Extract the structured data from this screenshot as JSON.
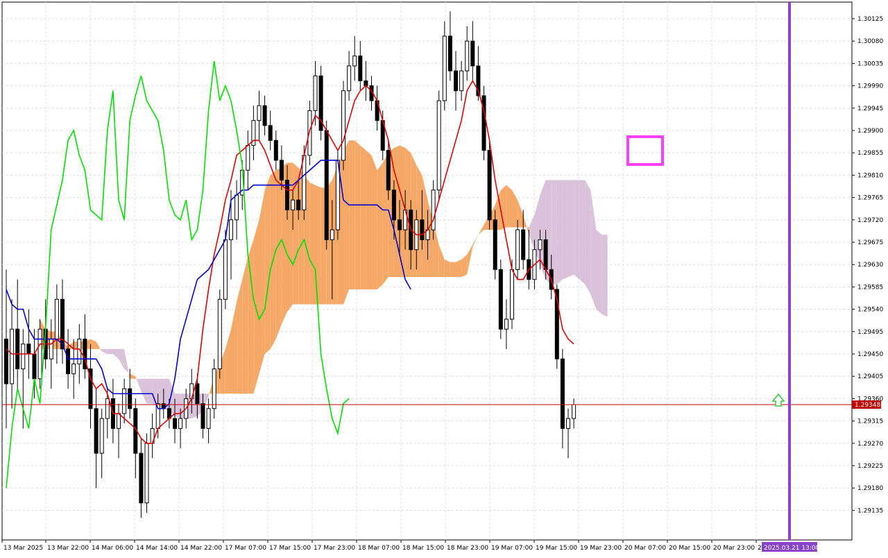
{
  "chart_data": {
    "type": "candlestick",
    "y_axis": {
      "ticks": [
        "1.30125",
        "1.30080",
        "1.30035",
        "1.29990",
        "1.29945",
        "1.29900",
        "1.29855",
        "1.29810",
        "1.29765",
        "1.29720",
        "1.29675",
        "1.29630",
        "1.29585",
        "1.29540",
        "1.29495",
        "1.29450",
        "1.29405",
        "1.29360",
        "1.29315",
        "1.29270",
        "1.29225",
        "1.29180",
        "1.29135"
      ],
      "range": [
        1.291,
        1.3016
      ],
      "position": "right"
    },
    "x_axis": {
      "ticks": [
        "13 Mar 2025",
        "13 Mar 22:00",
        "14 Mar 06:00",
        "14 Mar 14:00",
        "14 Mar 22:00",
        "17 Mar 07:00",
        "17 Mar 15:00",
        "17 Mar 23:00",
        "18 Mar 07:00",
        "18 Mar 15:00",
        "18 Mar 23:00",
        "19 Mar 07:00",
        "19 Mar 15:00",
        "19 Mar 23:00",
        "20 Mar 07:00",
        "20 Mar 15:00",
        "20 Mar 23:00",
        "21"
      ],
      "highlight_label": "2025.03.21 13:00"
    },
    "current_price": {
      "label": "1.29348",
      "value": 1.29348
    },
    "grid": true,
    "colors": {
      "bull_candle": "#ffffff",
      "bear_candle": "#000000",
      "tenkan": "#e00000",
      "kijun": "#0000d0",
      "chikou": "#00e000",
      "kumo_bull": "#f4a460",
      "kumo_bear": "#d8bfd8",
      "marker": "#ff40ff",
      "vline": "#9040d0",
      "arrow": "#32cd32",
      "price_line": "#c00000"
    },
    "candles": [
      [
        1.2948,
        1.2962,
        1.293,
        1.2939
      ],
      [
        1.2939,
        1.2956,
        1.2934,
        1.295
      ],
      [
        1.295,
        1.296,
        1.2938,
        1.2942
      ],
      [
        1.2942,
        1.295,
        1.293,
        1.2947
      ],
      [
        1.2947,
        1.2954,
        1.294,
        1.2945
      ],
      [
        1.2945,
        1.295,
        1.2936,
        1.294
      ],
      [
        1.294,
        1.2952,
        1.2938,
        1.295
      ],
      [
        1.295,
        1.2956,
        1.2942,
        1.2944
      ],
      [
        1.2944,
        1.2952,
        1.2938,
        1.2948
      ],
      [
        1.2948,
        1.2959,
        1.2943,
        1.2956
      ],
      [
        1.2956,
        1.296,
        1.2943,
        1.2946
      ],
      [
        1.2946,
        1.295,
        1.2938,
        1.2941
      ],
      [
        1.2941,
        1.2948,
        1.2936,
        1.2943
      ],
      [
        1.2943,
        1.2951,
        1.2939,
        1.2948
      ],
      [
        1.2948,
        1.2953,
        1.294,
        1.2942
      ],
      [
        1.2942,
        1.2947,
        1.293,
        1.2934
      ],
      [
        1.2934,
        1.2938,
        1.2918,
        1.2925
      ],
      [
        1.2925,
        1.2934,
        1.292,
        1.2932
      ],
      [
        1.2932,
        1.2938,
        1.2928,
        1.2936
      ],
      [
        1.2936,
        1.294,
        1.2927,
        1.293
      ],
      [
        1.293,
        1.2935,
        1.2924,
        1.2933
      ],
      [
        1.2933,
        1.294,
        1.2931,
        1.2938
      ],
      [
        1.2938,
        1.2942,
        1.2932,
        1.2934
      ],
      [
        1.2934,
        1.2936,
        1.292,
        1.2925
      ],
      [
        1.2925,
        1.2928,
        1.2912,
        1.2915
      ],
      [
        1.2915,
        1.2929,
        1.2913,
        1.2927
      ],
      [
        1.2927,
        1.2933,
        1.2924,
        1.293
      ],
      [
        1.293,
        1.2937,
        1.2928,
        1.2935
      ],
      [
        1.2935,
        1.2938,
        1.2932,
        1.2934
      ],
      [
        1.2934,
        1.2936,
        1.293,
        1.2932
      ],
      [
        1.2932,
        1.2936,
        1.2927,
        1.293
      ],
      [
        1.293,
        1.2934,
        1.2926,
        1.2932
      ],
      [
        1.2932,
        1.2938,
        1.293,
        1.2936
      ],
      [
        1.2936,
        1.2942,
        1.2933,
        1.2939
      ],
      [
        1.2939,
        1.2941,
        1.2932,
        1.2935
      ],
      [
        1.2935,
        1.2937,
        1.2928,
        1.293
      ],
      [
        1.293,
        1.2936,
        1.2927,
        1.2934
      ],
      [
        1.2934,
        1.2944,
        1.2932,
        1.2942
      ],
      [
        1.2942,
        1.2958,
        1.294,
        1.2956
      ],
      [
        1.2956,
        1.297,
        1.2954,
        1.2968
      ],
      [
        1.2968,
        1.2978,
        1.296,
        1.2972
      ],
      [
        1.2972,
        1.298,
        1.2968,
        1.2977
      ],
      [
        1.2977,
        1.2984,
        1.2974,
        1.2982
      ],
      [
        1.2982,
        1.299,
        1.2978,
        1.2987
      ],
      [
        1.2987,
        1.2995,
        1.2984,
        1.2992
      ],
      [
        1.2992,
        1.2998,
        1.2988,
        1.2995
      ],
      [
        1.2995,
        1.2997,
        1.2989,
        1.2991
      ],
      [
        1.2991,
        1.2994,
        1.2986,
        1.2988
      ],
      [
        1.2988,
        1.299,
        1.2982,
        1.2984
      ],
      [
        1.2984,
        1.2987,
        1.2978,
        1.298
      ],
      [
        1.298,
        1.2983,
        1.2972,
        1.2974
      ],
      [
        1.2974,
        1.2978,
        1.297,
        1.2976
      ],
      [
        1.2976,
        1.298,
        1.2972,
        1.2974
      ],
      [
        1.2974,
        1.2987,
        1.2972,
        1.2985
      ],
      [
        1.2985,
        1.2996,
        1.2983,
        1.2994
      ],
      [
        1.2994,
        1.3004,
        1.2991,
        1.3001
      ],
      [
        1.3001,
        1.3003,
        1.2988,
        1.299
      ],
      [
        1.299,
        1.2992,
        1.2966,
        1.2968
      ],
      [
        1.2968,
        1.2976,
        1.2956,
        1.297
      ],
      [
        1.297,
        1.2986,
        1.2968,
        1.2984
      ],
      [
        1.2984,
        1.3,
        1.2982,
        1.2998
      ],
      [
        1.2998,
        1.3006,
        1.2996,
        1.3003
      ],
      [
        1.3003,
        1.3009,
        1.3,
        1.3005
      ],
      [
        1.3005,
        1.3008,
        1.2998,
        1.3
      ],
      [
        1.3,
        1.3004,
        1.2996,
        1.2999
      ],
      [
        1.2999,
        1.3001,
        1.2994,
        1.2996
      ],
      [
        1.2996,
        1.2999,
        1.299,
        1.2992
      ],
      [
        1.2992,
        1.2994,
        1.2984,
        1.2986
      ],
      [
        1.2986,
        1.2988,
        1.2976,
        1.2978
      ],
      [
        1.2978,
        1.298,
        1.2968,
        1.2972
      ],
      [
        1.2972,
        1.2976,
        1.2965,
        1.297
      ],
      [
        1.297,
        1.2978,
        1.2966,
        1.2974
      ],
      [
        1.2974,
        1.2976,
        1.2962,
        1.2966
      ],
      [
        1.2966,
        1.2974,
        1.2962,
        1.2972
      ],
      [
        1.2972,
        1.2978,
        1.2966,
        1.2968
      ],
      [
        1.2968,
        1.2974,
        1.2964,
        1.297
      ],
      [
        1.297,
        1.298,
        1.2968,
        1.2978
      ],
      [
        1.2978,
        1.2998,
        1.2976,
        1.2996
      ],
      [
        1.2996,
        1.3012,
        1.2994,
        1.3009
      ],
      [
        1.3009,
        1.3014,
        1.3,
        1.3002
      ],
      [
        1.3002,
        1.3006,
        1.2994,
        1.2998
      ],
      [
        1.2998,
        1.3004,
        1.2996,
        1.3002
      ],
      [
        1.3002,
        1.3011,
        1.3,
        1.3008
      ],
      [
        1.3008,
        1.3012,
        1.3,
        1.3003
      ],
      [
        1.3003,
        1.3007,
        1.2996,
        1.2997
      ],
      [
        1.2997,
        1.2999,
        1.2984,
        1.2986
      ],
      [
        1.2986,
        1.2988,
        1.297,
        1.2972
      ],
      [
        1.2972,
        1.2974,
        1.296,
        1.2962
      ],
      [
        1.2962,
        1.2964,
        1.2948,
        1.295
      ],
      [
        1.295,
        1.2956,
        1.2946,
        1.2952
      ],
      [
        1.2952,
        1.2964,
        1.295,
        1.2962
      ],
      [
        1.2962,
        1.2972,
        1.296,
        1.297
      ],
      [
        1.297,
        1.2974,
        1.2962,
        1.2964
      ],
      [
        1.2964,
        1.297,
        1.2958,
        1.296
      ],
      [
        1.296,
        1.2968,
        1.2958,
        1.2966
      ],
      [
        1.2966,
        1.297,
        1.2962,
        1.2968
      ],
      [
        1.2968,
        1.297,
        1.296,
        1.2962
      ],
      [
        1.2962,
        1.2965,
        1.2956,
        1.2958
      ],
      [
        1.2958,
        1.2959,
        1.2942,
        1.2944
      ],
      [
        1.2944,
        1.2946,
        1.2926,
        1.293
      ],
      [
        1.293,
        1.2934,
        1.2924,
        1.2932
      ],
      [
        1.2932,
        1.2936,
        1.293,
        1.29348
      ]
    ],
    "tenkan": [
      1.2946,
      1.2945,
      1.2945,
      1.2945,
      1.2945,
      1.2945,
      1.2947,
      1.2947,
      1.2947,
      1.2948,
      1.2948,
      1.2947,
      1.2946,
      1.2946,
      1.2944,
      1.294,
      1.2938,
      1.2939,
      1.2937,
      1.2933,
      1.2933,
      1.2932,
      1.2931,
      1.293,
      1.2928,
      1.2927,
      1.2927,
      1.293,
      1.2931,
      1.2932,
      1.2933,
      1.2933,
      1.2934,
      1.2936,
      1.294,
      1.295,
      1.2958,
      1.2965,
      1.297,
      1.2976,
      1.298,
      1.2985,
      1.2986,
      1.2987,
      1.2988,
      1.2988,
      1.2986,
      1.2983,
      1.298,
      1.2979,
      1.2978,
      1.2978,
      1.298,
      1.2985,
      1.299,
      1.2993,
      1.2992,
      1.299,
      1.2988,
      1.2986,
      1.2988,
      1.2992,
      1.2996,
      1.2998,
      1.2999,
      1.2998,
      1.2996,
      1.2992,
      1.2988,
      1.2982,
      1.2978,
      1.2974,
      1.297,
      1.2969,
      1.2969,
      1.297,
      1.2972,
      1.2976,
      1.298,
      1.2984,
      1.2988,
      1.2992,
      1.2998,
      1.3,
      1.2998,
      1.2994,
      1.2988,
      1.298,
      1.2974,
      1.2968,
      1.2962,
      1.296,
      1.296,
      1.2962,
      1.2963,
      1.2964,
      1.2962,
      1.296,
      1.2956,
      1.295,
      1.2948,
      1.2947
    ],
    "kijun": [
      1.2958,
      1.2955,
      1.2954,
      1.2954,
      1.295,
      1.2948,
      1.2948,
      1.2948,
      1.2948,
      1.2948,
      1.2947,
      1.2944,
      1.2944,
      1.2944,
      1.2944,
      1.2944,
      1.2944,
      1.2942,
      1.2938,
      1.2937,
      1.2937,
      1.2937,
      1.2937,
      1.2937,
      1.2937,
      1.2937,
      1.2937,
      1.2934,
      1.2934,
      1.2935,
      1.294,
      1.2948,
      1.2952,
      1.2956,
      1.296,
      1.2961,
      1.2962,
      1.2964,
      1.2966,
      1.2968,
      1.2976,
      1.2977,
      1.2978,
      1.2978,
      1.2979,
      1.2979,
      1.2979,
      1.2979,
      1.2979,
      1.2979,
      1.2979,
      1.2979,
      1.298,
      1.2981,
      1.2982,
      1.2983,
      1.2984,
      1.2984,
      1.2984,
      1.2984,
      1.2976,
      1.2975,
      1.2975,
      1.2975,
      1.2975,
      1.2975,
      1.2975,
      1.2974,
      1.2974,
      1.297,
      1.2965,
      1.296,
      1.2958
    ],
    "chikou": [
      1.2918,
      1.293,
      1.2938,
      1.2934,
      1.293,
      1.294,
      1.2935,
      1.295,
      1.297,
      1.2975,
      1.298,
      1.2988,
      1.299,
      1.2985,
      1.2982,
      1.2974,
      1.2973,
      1.2972,
      1.299,
      1.2998,
      1.2976,
      1.2972,
      1.2992,
      1.2997,
      1.3001,
      1.2996,
      1.2994,
      1.2992,
      1.2986,
      1.2976,
      1.2973,
      1.2972,
      1.2976,
      1.2968,
      1.297,
      1.2978,
      1.2994,
      1.3004,
      1.2996,
      1.2999,
      1.2996,
      1.299,
      1.2983,
      1.2965,
      1.2956,
      1.2952,
      1.2954,
      1.2962,
      1.2966,
      1.2968,
      1.2965,
      1.2963,
      1.2966,
      1.2968,
      1.2964,
      1.2962,
      1.2945,
      1.2938,
      1.2932,
      1.2929,
      1.2935,
      1.2936
    ]
  }
}
